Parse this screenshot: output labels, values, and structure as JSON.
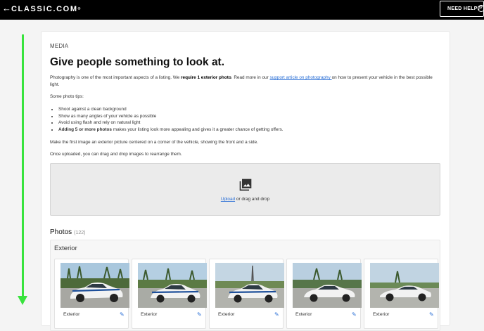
{
  "header": {
    "back_icon": "arrow-left-icon",
    "logo": "CLASSIC.COM",
    "logo_mark": "®",
    "help_label": "NEED HELP?",
    "help_icon": "question-circle-icon",
    "help_glyph": "?"
  },
  "media": {
    "section_label": "MEDIA",
    "heading": "Give people something to look at.",
    "intro": {
      "before_bold": "Photography is one of the most important aspects of a listing. We ",
      "bold": "require 1 exterior photo",
      "middle": ". Read more in our ",
      "link": "support article on photography ",
      "after": "on how to present your vehicle in the best possible light."
    },
    "tips_title": "Some photo tips:",
    "tips": [
      "Shoot against a clean background",
      "Show as many angles of your vehicle as possible",
      "Avoid using flash and rely on natural light"
    ],
    "tip_bold": "Adding 5 or more photos",
    "tip_bold_rest": " makes your listing look more appealing and gives it a greater chance of getting offers.",
    "make_first": "Make the first image an exterior picture centered on a corner of the vehicle, showing the front and a side.",
    "once_uploaded": "Once uploaded, you can drag and drop images to rearrange them.",
    "dropzone": {
      "icon": "photo-library-icon",
      "upload_link": "Upload",
      "drag_text": " or drag and drop"
    }
  },
  "photos": {
    "title": "Photos",
    "count": "(122)",
    "group_title": "Exterior",
    "items": [
      {
        "label": "Exterior",
        "edit_icon": "pencil-icon"
      },
      {
        "label": "Exterior",
        "edit_icon": "pencil-icon"
      },
      {
        "label": "Exterior",
        "edit_icon": "pencil-icon"
      },
      {
        "label": "Exterior",
        "edit_icon": "pencil-icon"
      },
      {
        "label": "Exterior",
        "edit_icon": "pencil-icon"
      }
    ]
  },
  "colors": {
    "header_bg": "#000000",
    "link": "#2a6fd6",
    "scroll_indicator": "#38e33d",
    "car_body": "#f2f2f2",
    "car_stripe": "#1d4f9a"
  }
}
